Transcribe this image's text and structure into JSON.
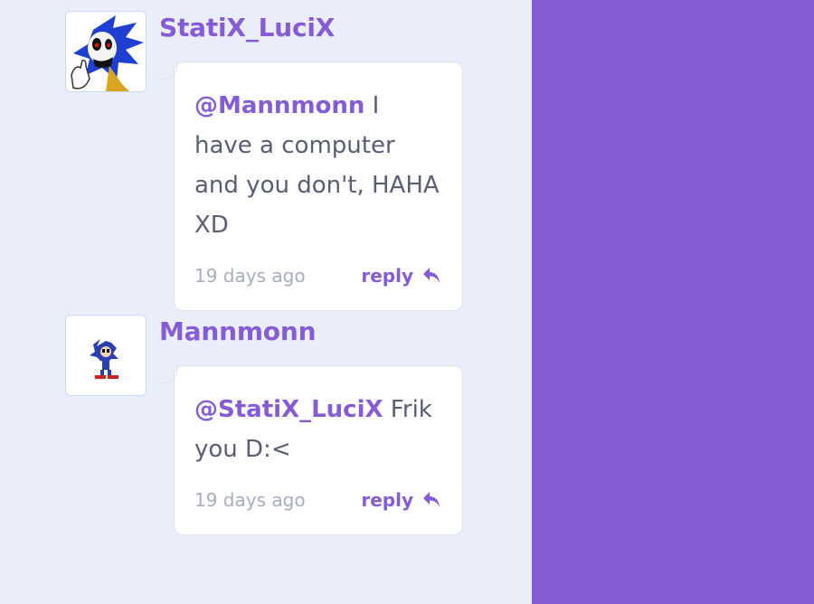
{
  "comments": [
    {
      "username": "StatiX_LuciX",
      "mention": "@Mannmonn",
      "text": " I have a computer and you don't, HAHA XD",
      "time": "19 days ago",
      "reply_label": "reply"
    },
    {
      "username": "Mannmonn",
      "mention": "@StatiX_LuciX",
      "text": " Frik you D:<",
      "time": "19 days ago",
      "reply_label": "reply"
    }
  ],
  "colors": {
    "accent": "#855cd6",
    "background": "#e9eefa",
    "text": "#575e75",
    "muted": "#a7adbb"
  }
}
